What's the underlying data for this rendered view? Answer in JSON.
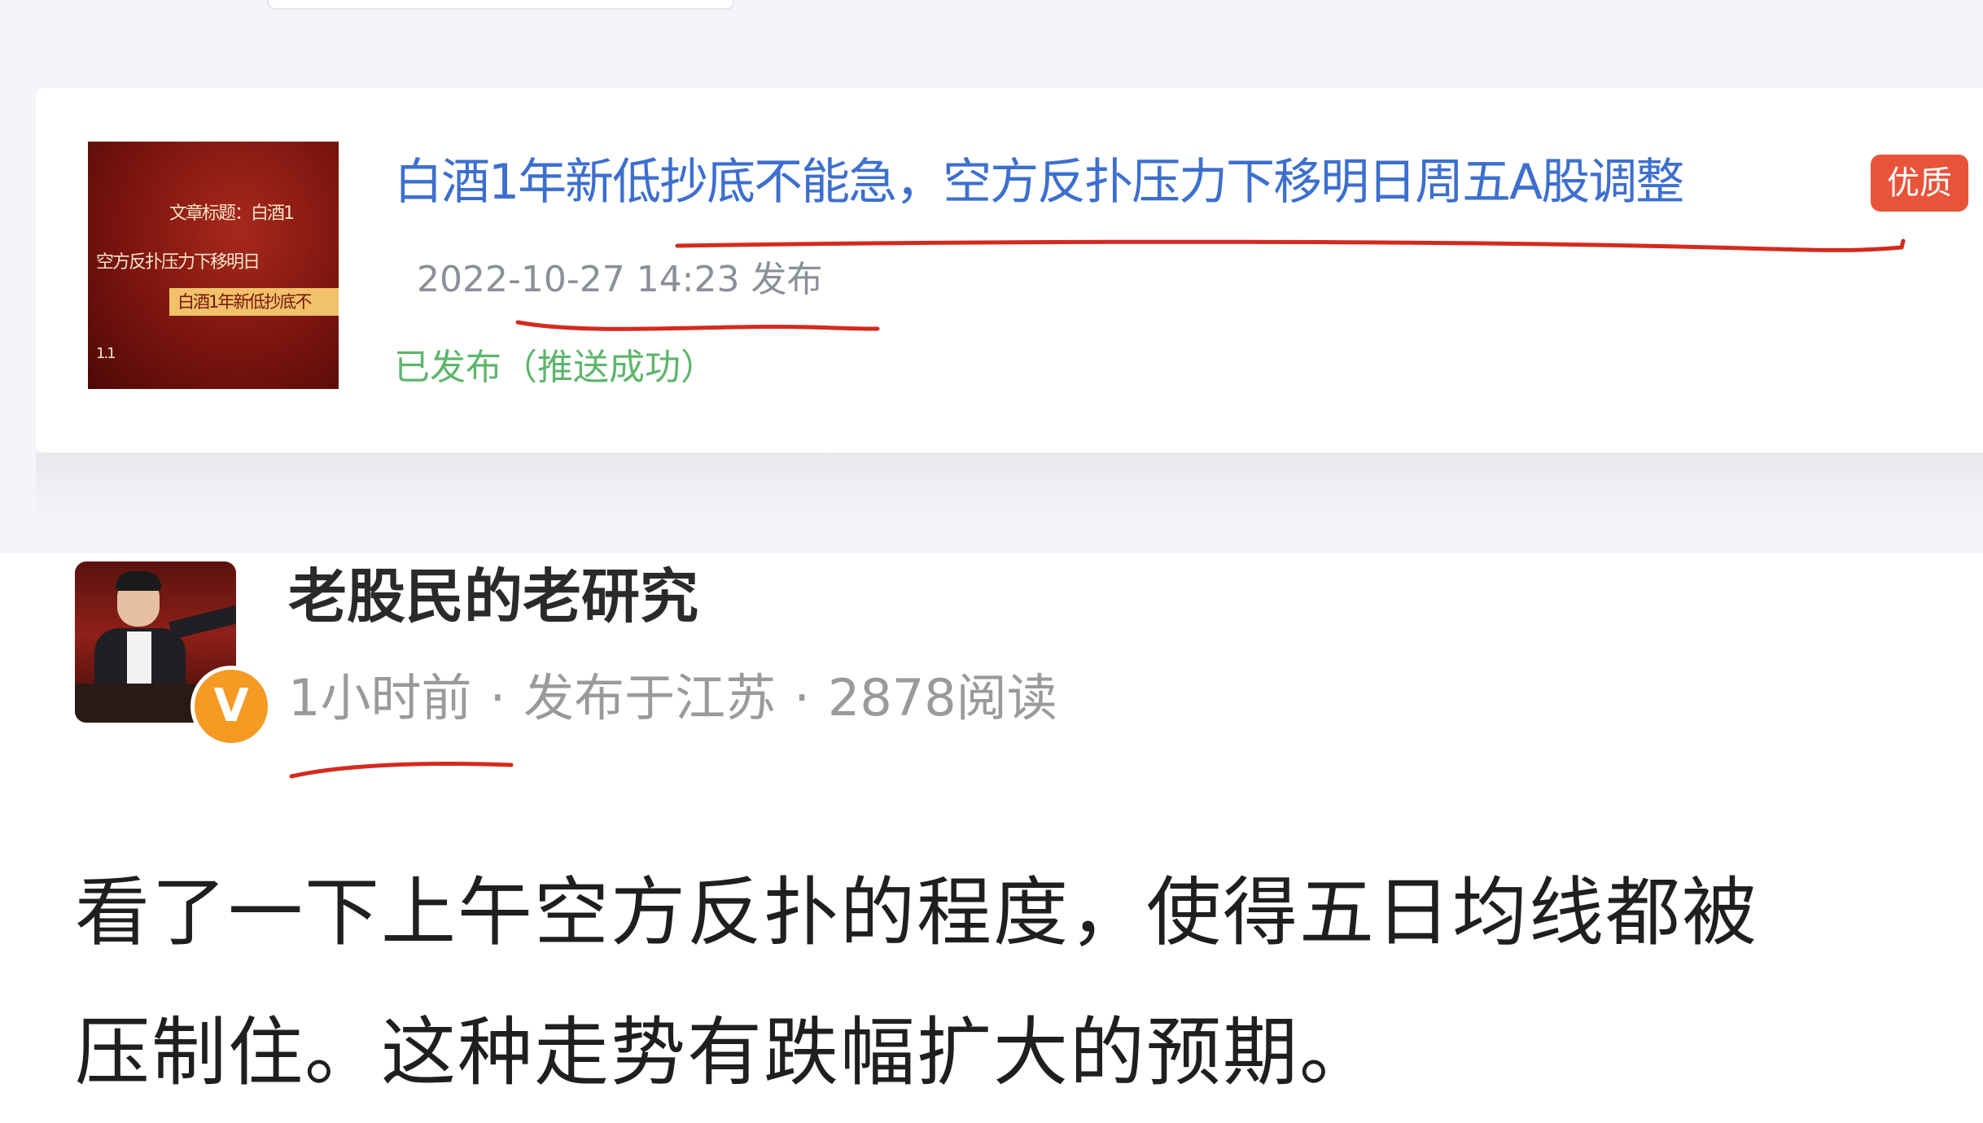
{
  "article": {
    "thumbnail": {
      "line1": "文章标题：白酒1",
      "line2": "空方反扑压力下移明日",
      "banner": "白酒1年新低抄底不",
      "corner": "1.1"
    },
    "title": "白酒1年新低抄底不能急，空方反扑压力下移明日周五A股调整",
    "badge": "优质",
    "publish_time": "2022-10-27 14:23 发布",
    "status": "已发布（推送成功）"
  },
  "post": {
    "author_name": "老股民的老研究",
    "verified_mark": "V",
    "time_ago": "1小时前",
    "location": "发布于江苏",
    "reads": "2878阅读",
    "separator": "·",
    "body_line1": "看了一下上午空方反扑的程度，使得五日均线都被",
    "body_line2": "压制住。这种走势有跌幅扩大的预期。"
  },
  "colors": {
    "title_blue": "#3d6fce",
    "status_green": "#5eb56d",
    "badge_red": "#e8543a",
    "verified_orange": "#f59a23",
    "annotation_red": "#d42a1f"
  },
  "icons": {
    "verified": "verified-v-icon"
  }
}
